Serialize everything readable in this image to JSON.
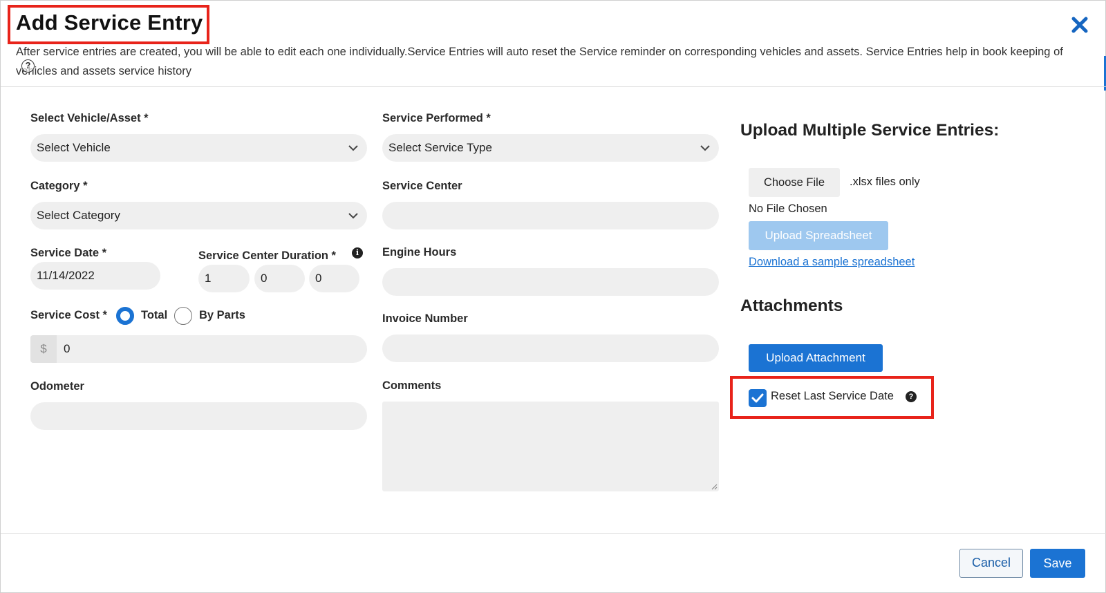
{
  "header": {
    "title": "Add Service Entry",
    "close_icon": "close-icon",
    "description": "After service entries are created, you will be able to edit each one individually.Service Entries will auto reset the Service reminder on corresponding vehicles and assets. Service Entries help in book keeping of vehicles and assets service history",
    "help_glyph": "?"
  },
  "form": {
    "vehicle": {
      "label": "Select Vehicle/Asset *",
      "value": "Select Vehicle"
    },
    "service_performed": {
      "label": "Service Performed *",
      "value": "Select Service Type"
    },
    "category": {
      "label": "Category *",
      "value": "Select Category"
    },
    "service_center": {
      "label": "Service Center",
      "value": ""
    },
    "service_date": {
      "label": "Service Date *",
      "value": "11/14/2022"
    },
    "service_center_duration": {
      "label": "Service Center Duration *",
      "values": [
        "1",
        "0",
        "0"
      ],
      "info_glyph": "i"
    },
    "engine_hours": {
      "label": "Engine Hours",
      "value": ""
    },
    "service_cost": {
      "label": "Service Cost *",
      "option_total": "Total",
      "option_by_parts": "By Parts",
      "selected": "Total",
      "currency": "$",
      "value": "0"
    },
    "invoice_number": {
      "label": "Invoice Number",
      "value": ""
    },
    "odometer": {
      "label": "Odometer",
      "value": ""
    },
    "comments": {
      "label": "Comments",
      "value": ""
    }
  },
  "upload": {
    "heading": "Upload Multiple Service Entries:",
    "choose_file": "Choose File",
    "file_hint": ".xlsx files only",
    "no_file": "No File Chosen",
    "upload_button": "Upload Spreadsheet",
    "sample_link": "Download a sample spreadsheet"
  },
  "attachments": {
    "heading": "Attachments",
    "upload_button": "Upload Attachment",
    "reset_label": "Reset Last Service Date",
    "reset_checked": true,
    "help_glyph": "?"
  },
  "footer": {
    "cancel": "Cancel",
    "save": "Save"
  },
  "colors": {
    "accent": "#1b73d3",
    "highlight": "#e8231a",
    "field_bg": "#efefef"
  }
}
